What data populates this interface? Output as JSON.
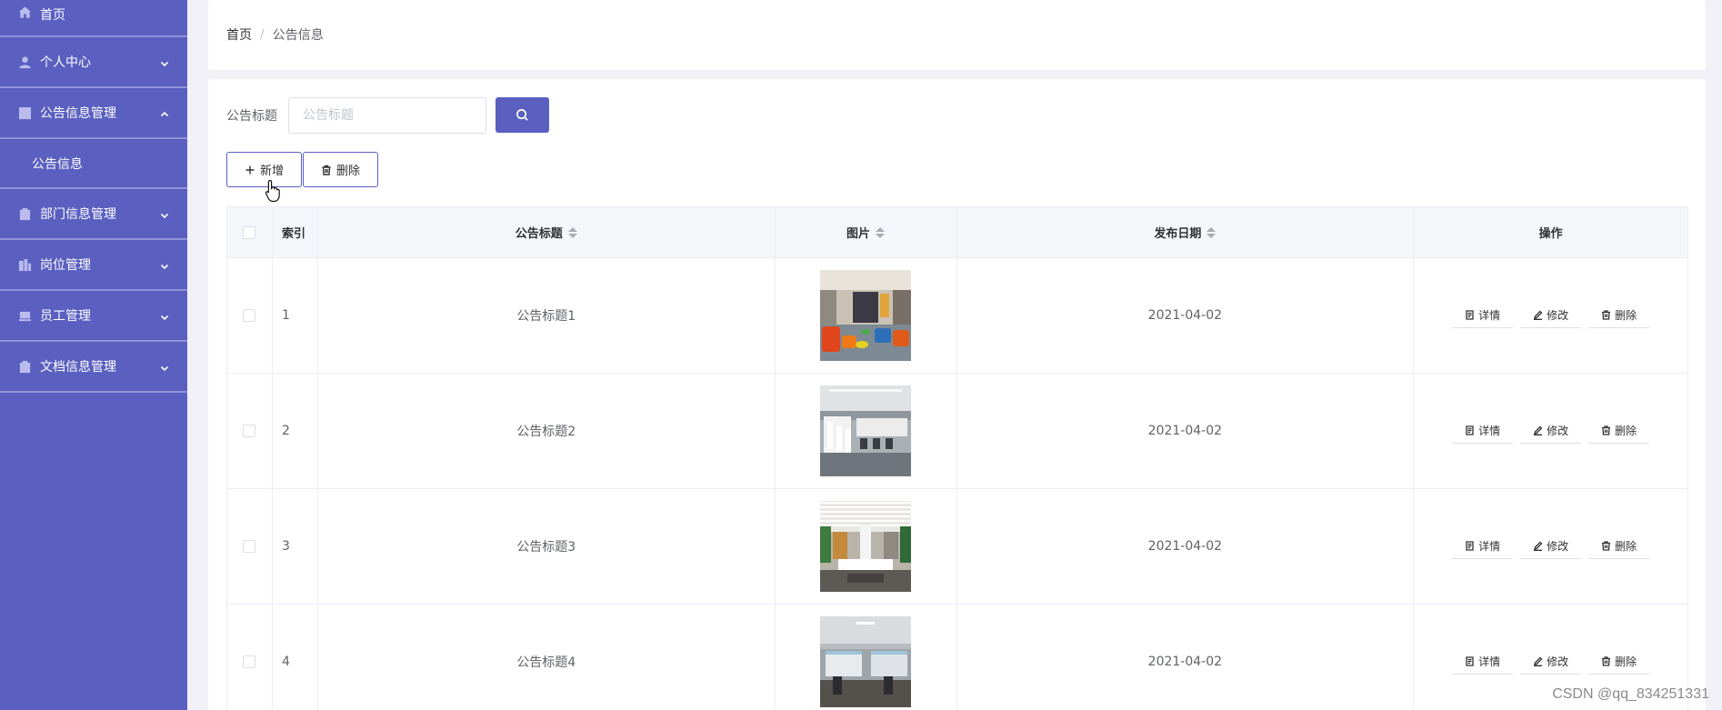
{
  "sidebar": {
    "items": [
      {
        "label": "首页",
        "icon": "home-icon",
        "expandable": false
      },
      {
        "label": "个人中心",
        "icon": "user-icon",
        "expandable": true,
        "expanded": false
      },
      {
        "label": "公告信息管理",
        "icon": "chart-icon",
        "expandable": true,
        "expanded": true
      },
      {
        "label": "部门信息管理",
        "icon": "clipboard-icon",
        "expandable": true,
        "expanded": false
      },
      {
        "label": "岗位管理",
        "icon": "buildings-icon",
        "expandable": true,
        "expanded": false
      },
      {
        "label": "员工管理",
        "icon": "computer-icon",
        "expandable": true,
        "expanded": false
      },
      {
        "label": "文档信息管理",
        "icon": "checklist-icon",
        "expandable": true,
        "expanded": false
      }
    ],
    "submenu": {
      "label": "公告信息"
    },
    "accent": "#5a5fc0"
  },
  "breadcrumb": {
    "home": "首页",
    "separator": "/",
    "current": "公告信息"
  },
  "search": {
    "label": "公告标题",
    "placeholder": "公告标题",
    "value": ""
  },
  "toolbar": {
    "add_label": "新增",
    "delete_label": "删除"
  },
  "table": {
    "headers": {
      "index": "索引",
      "title": "公告标题",
      "image": "图片",
      "date": "发布日期",
      "ops": "操作"
    },
    "rows": [
      {
        "index": "1",
        "title": "公告标题1",
        "image": "office-lounge-photo",
        "date": "2021-04-02"
      },
      {
        "index": "2",
        "title": "公告标题2",
        "image": "office-desks-photo",
        "date": "2021-04-02"
      },
      {
        "index": "3",
        "title": "公告标题3",
        "image": "office-reception-photo",
        "date": "2021-04-02"
      },
      {
        "index": "4",
        "title": "公告标题4",
        "image": "office-workstations-photo",
        "date": "2021-04-02"
      }
    ],
    "ops": {
      "detail": "详情",
      "edit": "修改",
      "delete": "删除"
    }
  },
  "watermark": "CSDN @qq_834251331"
}
